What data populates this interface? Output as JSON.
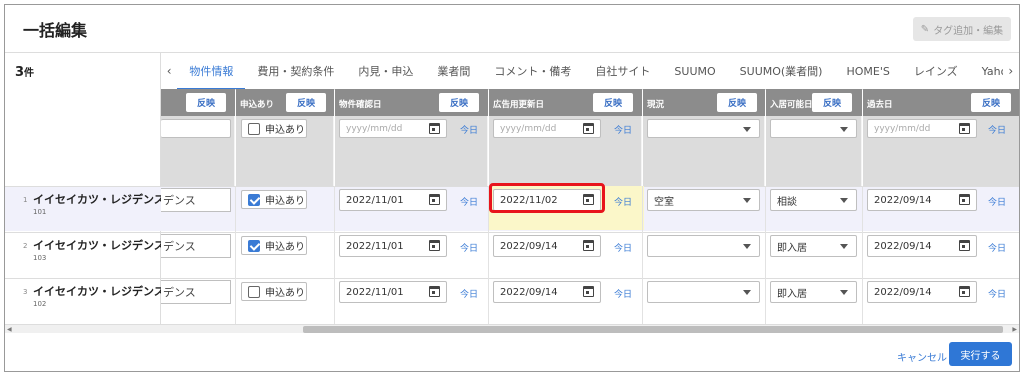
{
  "header": {
    "title": "一括編集",
    "tag_button_label": "タグ追加・編集"
  },
  "count": {
    "number": "3",
    "unit": "件"
  },
  "tabs": [
    "物件情報",
    "費用・契約条件",
    "内見・申込",
    "業者間",
    "コメント・備考",
    "自社サイト",
    "SUUMO",
    "SUUMO(業者間)",
    "HOME'S",
    "レインズ",
    "Yahoo"
  ],
  "active_tab_index": 0,
  "columns": {
    "col0": {
      "label": "",
      "reflect": "反映"
    },
    "moushikomi": {
      "label": "申込あり",
      "reflect": "反映"
    },
    "kakunin": {
      "label": "物件確認日",
      "reflect": "反映"
    },
    "koukoku": {
      "label": "広告用更新日",
      "reflect": "反映"
    },
    "genkyo": {
      "label": "現況",
      "reflect": "反映"
    },
    "nyukyo": {
      "label": "入居可能日",
      "reflect": "反映"
    },
    "kako": {
      "label": "過去日",
      "reflect": "反映"
    }
  },
  "bulk": {
    "checkbox_label": "申込あり",
    "date_placeholder": "yyyy/mm/dd",
    "today": "今日"
  },
  "rows": [
    {
      "num": "1",
      "name": "イイセイカツ・レジデンス",
      "room": "101",
      "name_cut": "デンス",
      "moushikomi": true,
      "moushikomi_label": "申込あり",
      "kakunin": "2022/11/01",
      "koukoku": "2022/11/02",
      "genkyo": "空室",
      "nyukyo": "相談",
      "kako": "2022/09/14",
      "selected": true
    },
    {
      "num": "2",
      "name": "イイセイカツ・レジデンス",
      "room": "103",
      "name_cut": "デンス",
      "moushikomi": true,
      "moushikomi_label": "申込あり",
      "kakunin": "2022/11/01",
      "koukoku": "2022/09/14",
      "genkyo": "",
      "nyukyo": "即入居",
      "kako": "2022/09/14",
      "selected": false
    },
    {
      "num": "3",
      "name": "イイセイカツ・レジデンス",
      "room": "102",
      "name_cut": "デンス",
      "moushikomi": false,
      "moushikomi_label": "申込あり",
      "kakunin": "2022/11/01",
      "koukoku": "2022/09/14",
      "genkyo": "",
      "nyukyo": "即入居",
      "kako": "2022/09/14",
      "selected": false
    }
  ],
  "footer": {
    "cancel": "キャンセル",
    "execute": "実行する"
  },
  "colors": {
    "accent": "#2f77d6",
    "highlight_border": "#e8141c",
    "highlight_cell": "#fbf7c9",
    "header_gray": "#8c8c8c"
  }
}
